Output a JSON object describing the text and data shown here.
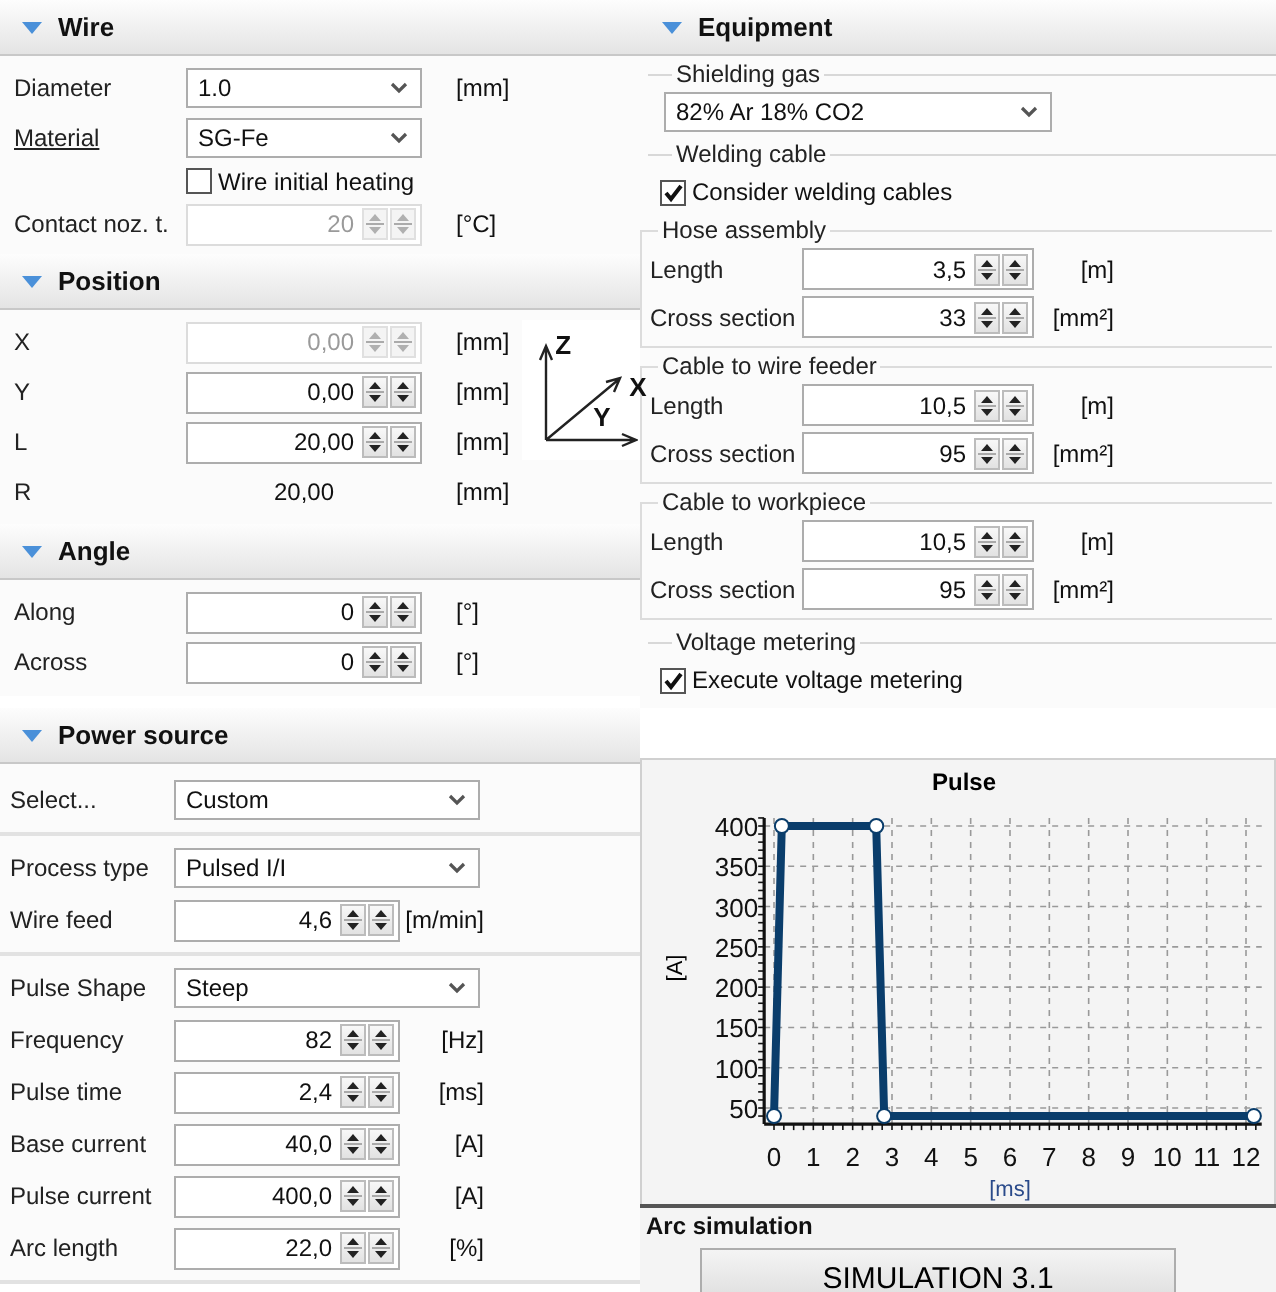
{
  "wire": {
    "title": "Wire",
    "expanded": true,
    "rows": [
      {
        "kind": "combo",
        "label": "Diameter",
        "link": false,
        "value": "1.0",
        "unit": "[mm]"
      },
      {
        "kind": "combo",
        "label": "Material",
        "link": true,
        "value": "SG-Fe"
      },
      {
        "kind": "check",
        "label": "Wire initial heating",
        "checked": false
      },
      {
        "kind": "spin",
        "label": "Contact noz. t.",
        "link": false,
        "value": "20",
        "unit": "[°C]",
        "disabled": true
      }
    ]
  },
  "position": {
    "title": "Position",
    "expanded": true,
    "axes": [
      "Z",
      "X",
      "Y"
    ],
    "rows": [
      {
        "kind": "spin",
        "label": "X",
        "value": "0,00",
        "unit": "[mm]",
        "disabled": true
      },
      {
        "kind": "spin",
        "label": "Y",
        "value": "0,00",
        "unit": "[mm]",
        "disabled": false
      },
      {
        "kind": "spin",
        "label": "L",
        "value": "20,00",
        "unit": "[mm]",
        "disabled": false
      },
      {
        "kind": "readout",
        "label": "R",
        "value": "20,00",
        "unit": "[mm]"
      }
    ]
  },
  "angle": {
    "title": "Angle",
    "expanded": true,
    "rows": [
      {
        "kind": "spin",
        "label": "Along",
        "value": "0",
        "unit": "[°]",
        "disabled": false
      },
      {
        "kind": "spin",
        "label": "Across",
        "value": "0",
        "unit": "[°]",
        "disabled": false
      }
    ]
  },
  "power_source": {
    "title": "Power source",
    "expanded": true,
    "groups": [
      [
        {
          "kind": "combo",
          "label": "Select...",
          "value": "Custom"
        }
      ],
      [
        {
          "kind": "combo",
          "label": "Process type",
          "value": "Pulsed I/I"
        },
        {
          "kind": "spin",
          "label": "Wire feed",
          "value": "4,6",
          "unit": "[m/min]",
          "disabled": false
        }
      ],
      [
        {
          "kind": "combo",
          "label": "Pulse Shape",
          "value": "Steep"
        },
        {
          "kind": "spin",
          "label": "Frequency",
          "value": "82",
          "unit": "[Hz]",
          "disabled": false
        },
        {
          "kind": "spin",
          "label": "Pulse time",
          "value": "2,4",
          "unit": "[ms]",
          "disabled": false
        },
        {
          "kind": "spin",
          "label": "Base current",
          "value": "40,0",
          "unit": "[A]",
          "disabled": false
        },
        {
          "kind": "spin",
          "label": "Pulse current",
          "value": "400,0",
          "unit": "[A]",
          "disabled": false
        },
        {
          "kind": "spin",
          "label": "Arc length",
          "value": "22,0",
          "unit": "[%]",
          "disabled": false
        }
      ]
    ]
  },
  "equipment": {
    "title": "Equipment",
    "expanded": true,
    "groups": [
      {
        "title": "Shielding gas",
        "items": [
          {
            "kind": "combo",
            "value": "82% Ar 18% CO2"
          }
        ]
      },
      {
        "title": "Welding cable",
        "items": [
          {
            "kind": "check",
            "label": "Consider welding cables",
            "checked": true
          },
          {
            "kind": "subgroup",
            "title": "Hose assembly",
            "rows": [
              {
                "kind": "spin",
                "label": "Length",
                "value": "3,5",
                "unit": "[m]",
                "disabled": false
              },
              {
                "kind": "spin",
                "label": "Cross section",
                "value": "33",
                "unit": "[mm²]",
                "disabled": false
              }
            ]
          },
          {
            "kind": "subgroup",
            "title": "Cable to wire feeder",
            "rows": [
              {
                "kind": "spin",
                "label": "Length",
                "value": "10,5",
                "unit": "[m]",
                "disabled": false
              },
              {
                "kind": "spin",
                "label": "Cross section",
                "value": "95",
                "unit": "[mm²]",
                "disabled": false
              }
            ]
          },
          {
            "kind": "subgroup",
            "title": "Cable to workpiece",
            "rows": [
              {
                "kind": "spin",
                "label": "Length",
                "value": "10,5",
                "unit": "[m]",
                "disabled": false
              },
              {
                "kind": "spin",
                "label": "Cross section",
                "value": "95",
                "unit": "[mm²]",
                "disabled": false
              }
            ]
          }
        ]
      },
      {
        "title": "Voltage metering",
        "items": [
          {
            "kind": "check",
            "label": "Execute voltage metering",
            "checked": true
          }
        ]
      }
    ]
  },
  "pulse_chart": {
    "chart_data": {
      "type": "line",
      "title": "Pulse",
      "xlabel": "[ms]",
      "ylabel": "[A]",
      "x": [
        0,
        0.2,
        2.6,
        2.8,
        12.2
      ],
      "series": [
        {
          "color": "#0a3d6b",
          "marker": "circle",
          "values": [
            40,
            400,
            400,
            40,
            40
          ]
        }
      ],
      "grid": true,
      "xlim": [
        -0.25,
        12.4
      ],
      "ylim": [
        30,
        410
      ],
      "xticks": [
        0,
        1,
        2,
        3,
        4,
        5,
        6,
        7,
        8,
        9,
        10,
        11,
        12
      ],
      "yticks": [
        50,
        100,
        150,
        200,
        250,
        300,
        350,
        400
      ]
    }
  },
  "arc_simulation": {
    "title": "Arc simulation",
    "button": "SIMULATION 3.1"
  }
}
